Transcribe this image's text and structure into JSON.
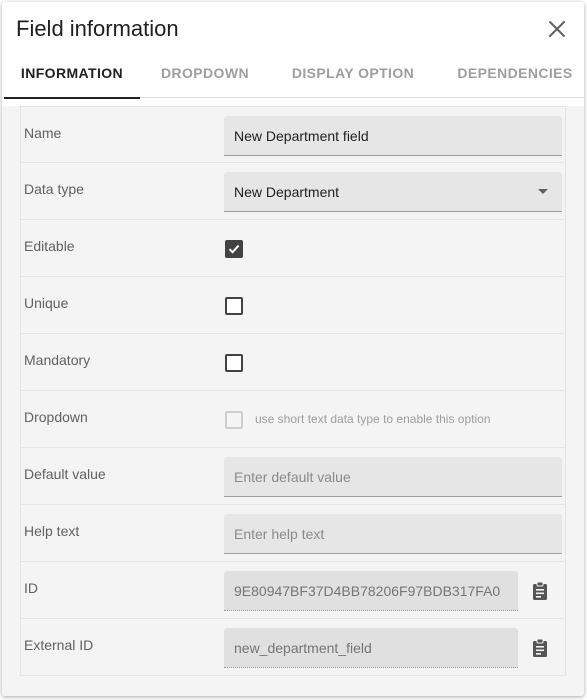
{
  "dialog": {
    "title": "Field information",
    "close_icon": "close-icon"
  },
  "tabs": [
    {
      "label": "INFORMATION",
      "active": true
    },
    {
      "label": "DROPDOWN",
      "active": false
    },
    {
      "label": "DISPLAY OPTION",
      "active": false
    },
    {
      "label": "DEPENDENCIES",
      "active": false
    }
  ],
  "form": {
    "name": {
      "label": "Name",
      "value": "New Department field"
    },
    "data_type": {
      "label": "Data type",
      "value": "New Department"
    },
    "editable": {
      "label": "Editable",
      "checked": true
    },
    "unique": {
      "label": "Unique",
      "checked": false
    },
    "mandatory": {
      "label": "Mandatory",
      "checked": false
    },
    "dropdown": {
      "label": "Dropdown",
      "checked": false,
      "disabled": true,
      "hint": "use short text data type to enable this option"
    },
    "default_value": {
      "label": "Default value",
      "value": "",
      "placeholder": "Enter default value"
    },
    "help_text": {
      "label": "Help text",
      "value": "",
      "placeholder": "Enter help text"
    },
    "id": {
      "label": "ID",
      "value": "9E80947BF37D4BB78206F97BDB317FA0",
      "icon": "clipboard-icon"
    },
    "external_id": {
      "label": "External ID",
      "value": "new_department_field",
      "icon": "clipboard-icon"
    }
  },
  "colors": {
    "accent": "#212121",
    "field_bg": "#e6e6e6",
    "panel_bg": "#f4f4f4",
    "muted_text": "#9e9e9e"
  }
}
